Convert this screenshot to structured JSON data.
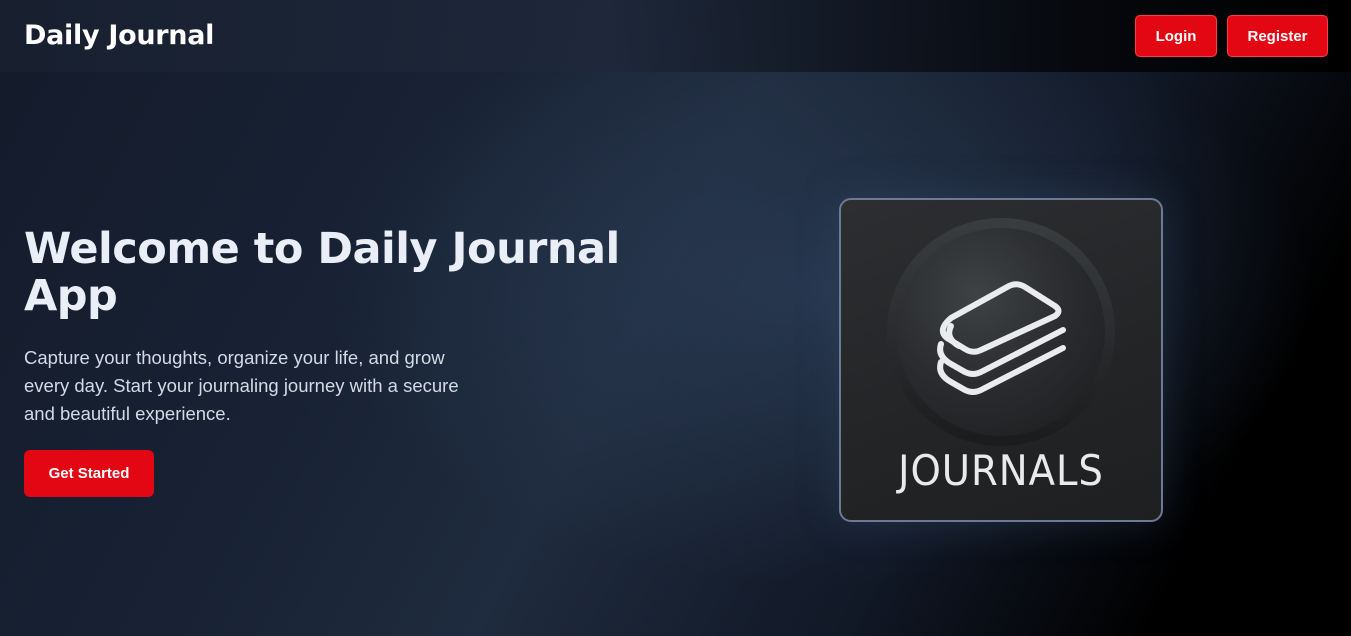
{
  "navbar": {
    "brand": "Daily Journal",
    "login_label": "Login",
    "register_label": "Register"
  },
  "hero": {
    "title": "Welcome to Daily Journal App",
    "description": "Capture your thoughts, organize your life, and grow every day. Start your journaling journey with a secure and beautiful experience.",
    "cta_label": "Get Started"
  },
  "logo": {
    "word": "JOURNALS",
    "icon": "stacked-books-icon"
  },
  "colors": {
    "accent": "#e30613",
    "text": "#e9eef7",
    "card_border": "#6c7a94"
  }
}
